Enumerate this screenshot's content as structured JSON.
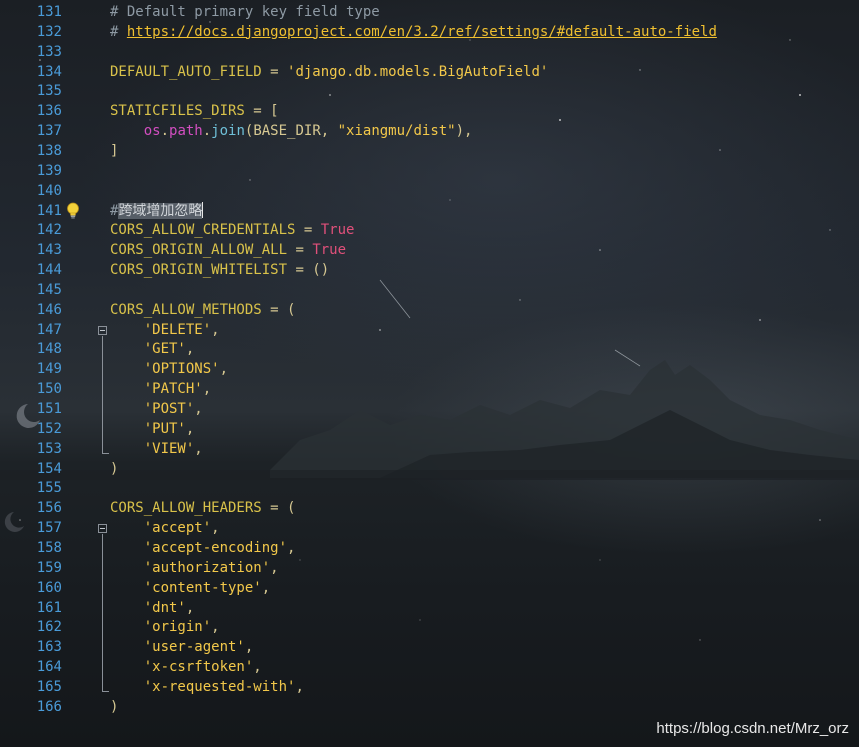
{
  "lines": [
    {
      "num": "131",
      "parts": [
        {
          "t": "# Default primary key field type",
          "c": "comment"
        }
      ]
    },
    {
      "num": "132",
      "parts": [
        {
          "t": "# ",
          "c": "comment"
        },
        {
          "t": "https://docs.djangoproject.com/en/3.2/ref/settings/#default-auto-field",
          "c": "link"
        }
      ]
    },
    {
      "num": "133",
      "parts": []
    },
    {
      "num": "134",
      "parts": [
        {
          "t": "DEFAULT_AUTO_FIELD",
          "c": "ident"
        },
        {
          "t": " = ",
          "c": "op"
        },
        {
          "t": "'django.db.models.BigAutoField'",
          "c": "str"
        }
      ]
    },
    {
      "num": "135",
      "parts": []
    },
    {
      "num": "136",
      "parts": [
        {
          "t": "STATICFILES_DIRS",
          "c": "ident"
        },
        {
          "t": " = [",
          "c": "op"
        }
      ]
    },
    {
      "num": "137",
      "parts": [
        {
          "t": "    ",
          "c": "op"
        },
        {
          "t": "os",
          "c": "mod"
        },
        {
          "t": ".",
          "c": "op"
        },
        {
          "t": "path",
          "c": "mod"
        },
        {
          "t": ".",
          "c": "op"
        },
        {
          "t": "join",
          "c": "fn"
        },
        {
          "t": "(BASE_DIR, ",
          "c": "op"
        },
        {
          "t": "\"xiangmu/dist\"",
          "c": "str"
        },
        {
          "t": "),",
          "c": "op"
        }
      ]
    },
    {
      "num": "138",
      "parts": [
        {
          "t": "]",
          "c": "op"
        }
      ]
    },
    {
      "num": "139",
      "parts": []
    },
    {
      "num": "140",
      "parts": []
    },
    {
      "num": "141",
      "parts": [
        {
          "t": "#",
          "c": "comment"
        },
        {
          "t": "跨域增加忽略",
          "c": "hl"
        }
      ],
      "bulb": true,
      "caret": true
    },
    {
      "num": "142",
      "parts": [
        {
          "t": "CORS_ALLOW_CREDENTIALS",
          "c": "ident"
        },
        {
          "t": " = ",
          "c": "op"
        },
        {
          "t": "True",
          "c": "kw"
        }
      ]
    },
    {
      "num": "143",
      "parts": [
        {
          "t": "CORS_ORIGIN_ALLOW_ALL",
          "c": "ident"
        },
        {
          "t": " = ",
          "c": "op"
        },
        {
          "t": "True",
          "c": "kw"
        }
      ]
    },
    {
      "num": "144",
      "parts": [
        {
          "t": "CORS_ORIGIN_WHITELIST",
          "c": "ident"
        },
        {
          "t": " = ()",
          "c": "op"
        }
      ]
    },
    {
      "num": "145",
      "parts": []
    },
    {
      "num": "146",
      "parts": [
        {
          "t": "CORS_ALLOW_METHODS",
          "c": "ident"
        },
        {
          "t": " = (",
          "c": "op"
        }
      ]
    },
    {
      "num": "147",
      "parts": [
        {
          "t": "    ",
          "c": "op"
        },
        {
          "t": "'DELETE'",
          "c": "str"
        },
        {
          "t": ",",
          "c": "op"
        }
      ],
      "fold": true
    },
    {
      "num": "148",
      "parts": [
        {
          "t": "    ",
          "c": "op"
        },
        {
          "t": "'GET'",
          "c": "str"
        },
        {
          "t": ",",
          "c": "op"
        }
      ]
    },
    {
      "num": "149",
      "parts": [
        {
          "t": "    ",
          "c": "op"
        },
        {
          "t": "'OPTIONS'",
          "c": "str"
        },
        {
          "t": ",",
          "c": "op"
        }
      ]
    },
    {
      "num": "150",
      "parts": [
        {
          "t": "    ",
          "c": "op"
        },
        {
          "t": "'PATCH'",
          "c": "str"
        },
        {
          "t": ",",
          "c": "op"
        }
      ]
    },
    {
      "num": "151",
      "parts": [
        {
          "t": "    ",
          "c": "op"
        },
        {
          "t": "'POST'",
          "c": "str"
        },
        {
          "t": ",",
          "c": "op"
        }
      ]
    },
    {
      "num": "152",
      "parts": [
        {
          "t": "    ",
          "c": "op"
        },
        {
          "t": "'PUT'",
          "c": "str"
        },
        {
          "t": ",",
          "c": "op"
        }
      ]
    },
    {
      "num": "153",
      "parts": [
        {
          "t": "    ",
          "c": "op"
        },
        {
          "t": "'VIEW'",
          "c": "str"
        },
        {
          "t": ",",
          "c": "op"
        }
      ],
      "foldEnd": true
    },
    {
      "num": "154",
      "parts": [
        {
          "t": ")",
          "c": "op"
        }
      ]
    },
    {
      "num": "155",
      "parts": []
    },
    {
      "num": "156",
      "parts": [
        {
          "t": "CORS_ALLOW_HEADERS",
          "c": "ident"
        },
        {
          "t": " = (",
          "c": "op"
        }
      ]
    },
    {
      "num": "157",
      "parts": [
        {
          "t": "    ",
          "c": "op"
        },
        {
          "t": "'accept'",
          "c": "str"
        },
        {
          "t": ",",
          "c": "op"
        }
      ],
      "fold": true
    },
    {
      "num": "158",
      "parts": [
        {
          "t": "    ",
          "c": "op"
        },
        {
          "t": "'accept-encoding'",
          "c": "str"
        },
        {
          "t": ",",
          "c": "op"
        }
      ]
    },
    {
      "num": "159",
      "parts": [
        {
          "t": "    ",
          "c": "op"
        },
        {
          "t": "'authorization'",
          "c": "str"
        },
        {
          "t": ",",
          "c": "op"
        }
      ]
    },
    {
      "num": "160",
      "parts": [
        {
          "t": "    ",
          "c": "op"
        },
        {
          "t": "'content-type'",
          "c": "str"
        },
        {
          "t": ",",
          "c": "op"
        }
      ]
    },
    {
      "num": "161",
      "parts": [
        {
          "t": "    ",
          "c": "op"
        },
        {
          "t": "'dnt'",
          "c": "str"
        },
        {
          "t": ",",
          "c": "op"
        }
      ]
    },
    {
      "num": "162",
      "parts": [
        {
          "t": "    ",
          "c": "op"
        },
        {
          "t": "'origin'",
          "c": "str"
        },
        {
          "t": ",",
          "c": "op"
        }
      ]
    },
    {
      "num": "163",
      "parts": [
        {
          "t": "    ",
          "c": "op"
        },
        {
          "t": "'user-agent'",
          "c": "str"
        },
        {
          "t": ",",
          "c": "op"
        }
      ]
    },
    {
      "num": "164",
      "parts": [
        {
          "t": "    ",
          "c": "op"
        },
        {
          "t": "'x-csrftoken'",
          "c": "str"
        },
        {
          "t": ",",
          "c": "op"
        }
      ]
    },
    {
      "num": "165",
      "parts": [
        {
          "t": "    ",
          "c": "op"
        },
        {
          "t": "'x-requested-with'",
          "c": "str"
        },
        {
          "t": ",",
          "c": "op"
        }
      ],
      "foldEnd": true
    },
    {
      "num": "166",
      "parts": [
        {
          "t": ")",
          "c": "op"
        }
      ]
    }
  ],
  "watermark": "https://blog.csdn.net/Mrz_orz",
  "icons": {
    "bulb": "lightbulb-icon",
    "fold": "fold-toggle-icon"
  },
  "colors": {
    "line_numbers": "#4a9bd8",
    "comment": "#8e9aa4",
    "string": "#f2c84a",
    "keyword": "#e0507a",
    "identifier": "#d9c24a"
  }
}
